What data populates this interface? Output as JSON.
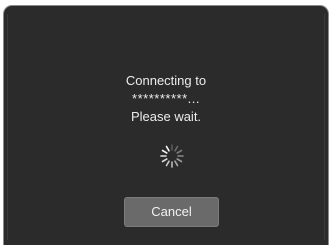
{
  "dialog": {
    "line1": "Connecting to",
    "line2": "**********...",
    "line3": "Please wait.",
    "spinner_icon": "loading-spinner-icon",
    "cancel_label": "Cancel"
  },
  "colors": {
    "background": "#2b2b2b",
    "text": "#ececec",
    "button": "#6a6a6a"
  }
}
